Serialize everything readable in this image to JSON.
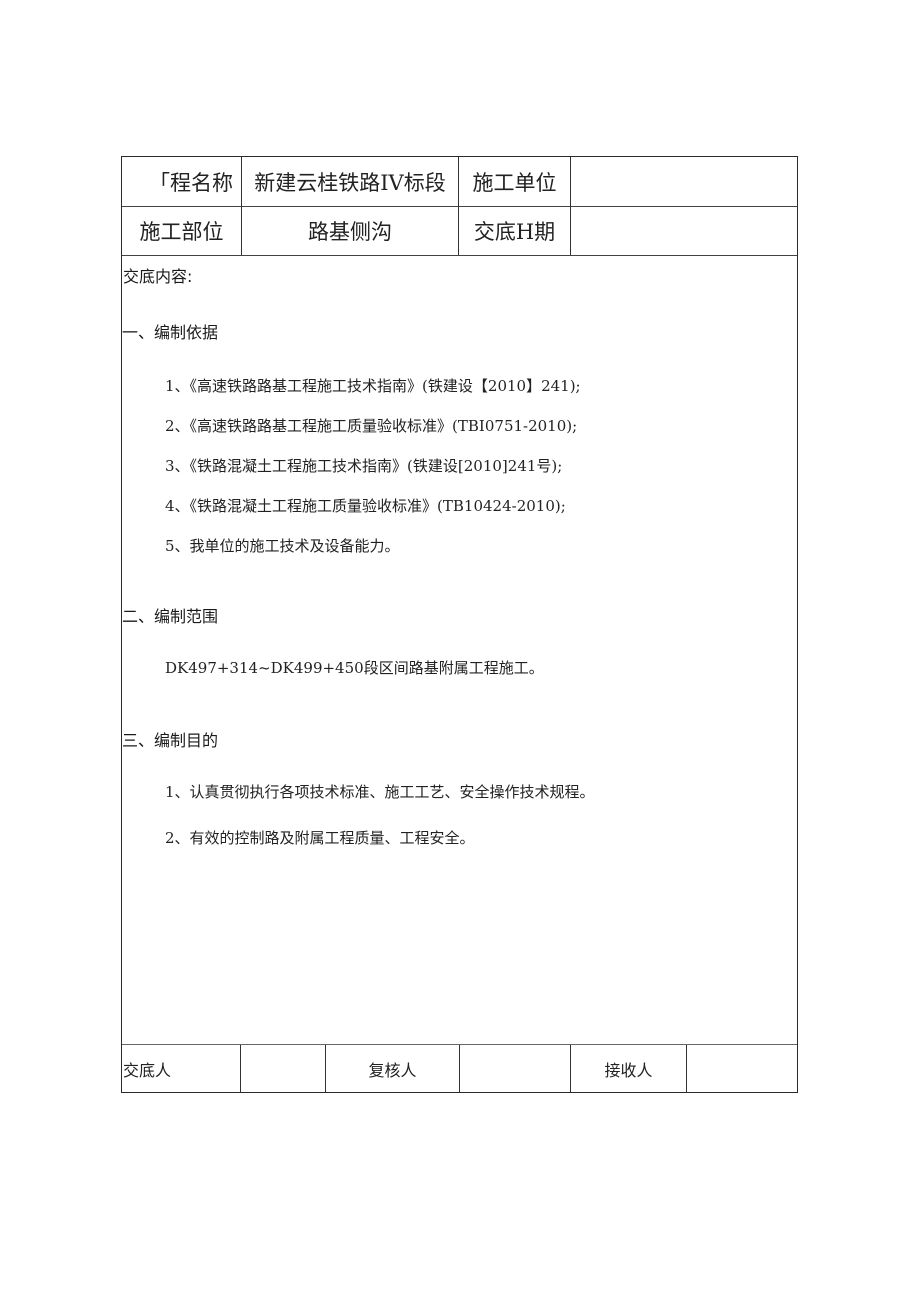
{
  "header_table": {
    "row1": {
      "project_name_label": "「程名称",
      "project_name_value": "新建云桂铁路IV标段",
      "construction_unit_label": "施工单位",
      "construction_unit_value": ""
    },
    "row2": {
      "construction_part_label": "施工部位",
      "construction_part_value": "路基侧沟",
      "handover_date_label": "交底H期",
      "handover_date_value": ""
    }
  },
  "content": {
    "label": "交底内容:",
    "sections": [
      {
        "heading": "一、编制依据",
        "items": [
          "1、《高速铁路路基工程施工技术指南》(铁建设【2010】241);",
          "2、《高速铁路路基工程施工质量验收标准》(TBI0751-2010);",
          "3、《铁路混凝土工程施工技术指南》(铁建设[2010]241号);",
          "4、《铁路混凝土工程施工质量验收标准》(TB10424-2010);",
          "5、我单位的施工技术及设备能力。"
        ]
      },
      {
        "heading": "二、编制范围",
        "items": [
          "DK497+314~DK499+450段区间路基附属工程施工。"
        ]
      },
      {
        "heading": "三、编制目的",
        "items": [
          "1、认真贯彻执行各项技术标准、施工工艺、安全操作技术规程。",
          "2、有效的控制路及附属工程质量、工程安全。"
        ]
      }
    ]
  },
  "footer_table": {
    "handover_person_label": "交底人",
    "handover_person_value": "",
    "reviewer_label": "复核人",
    "reviewer_value": "",
    "receiver_label": "接收人",
    "receiver_value": ""
  }
}
